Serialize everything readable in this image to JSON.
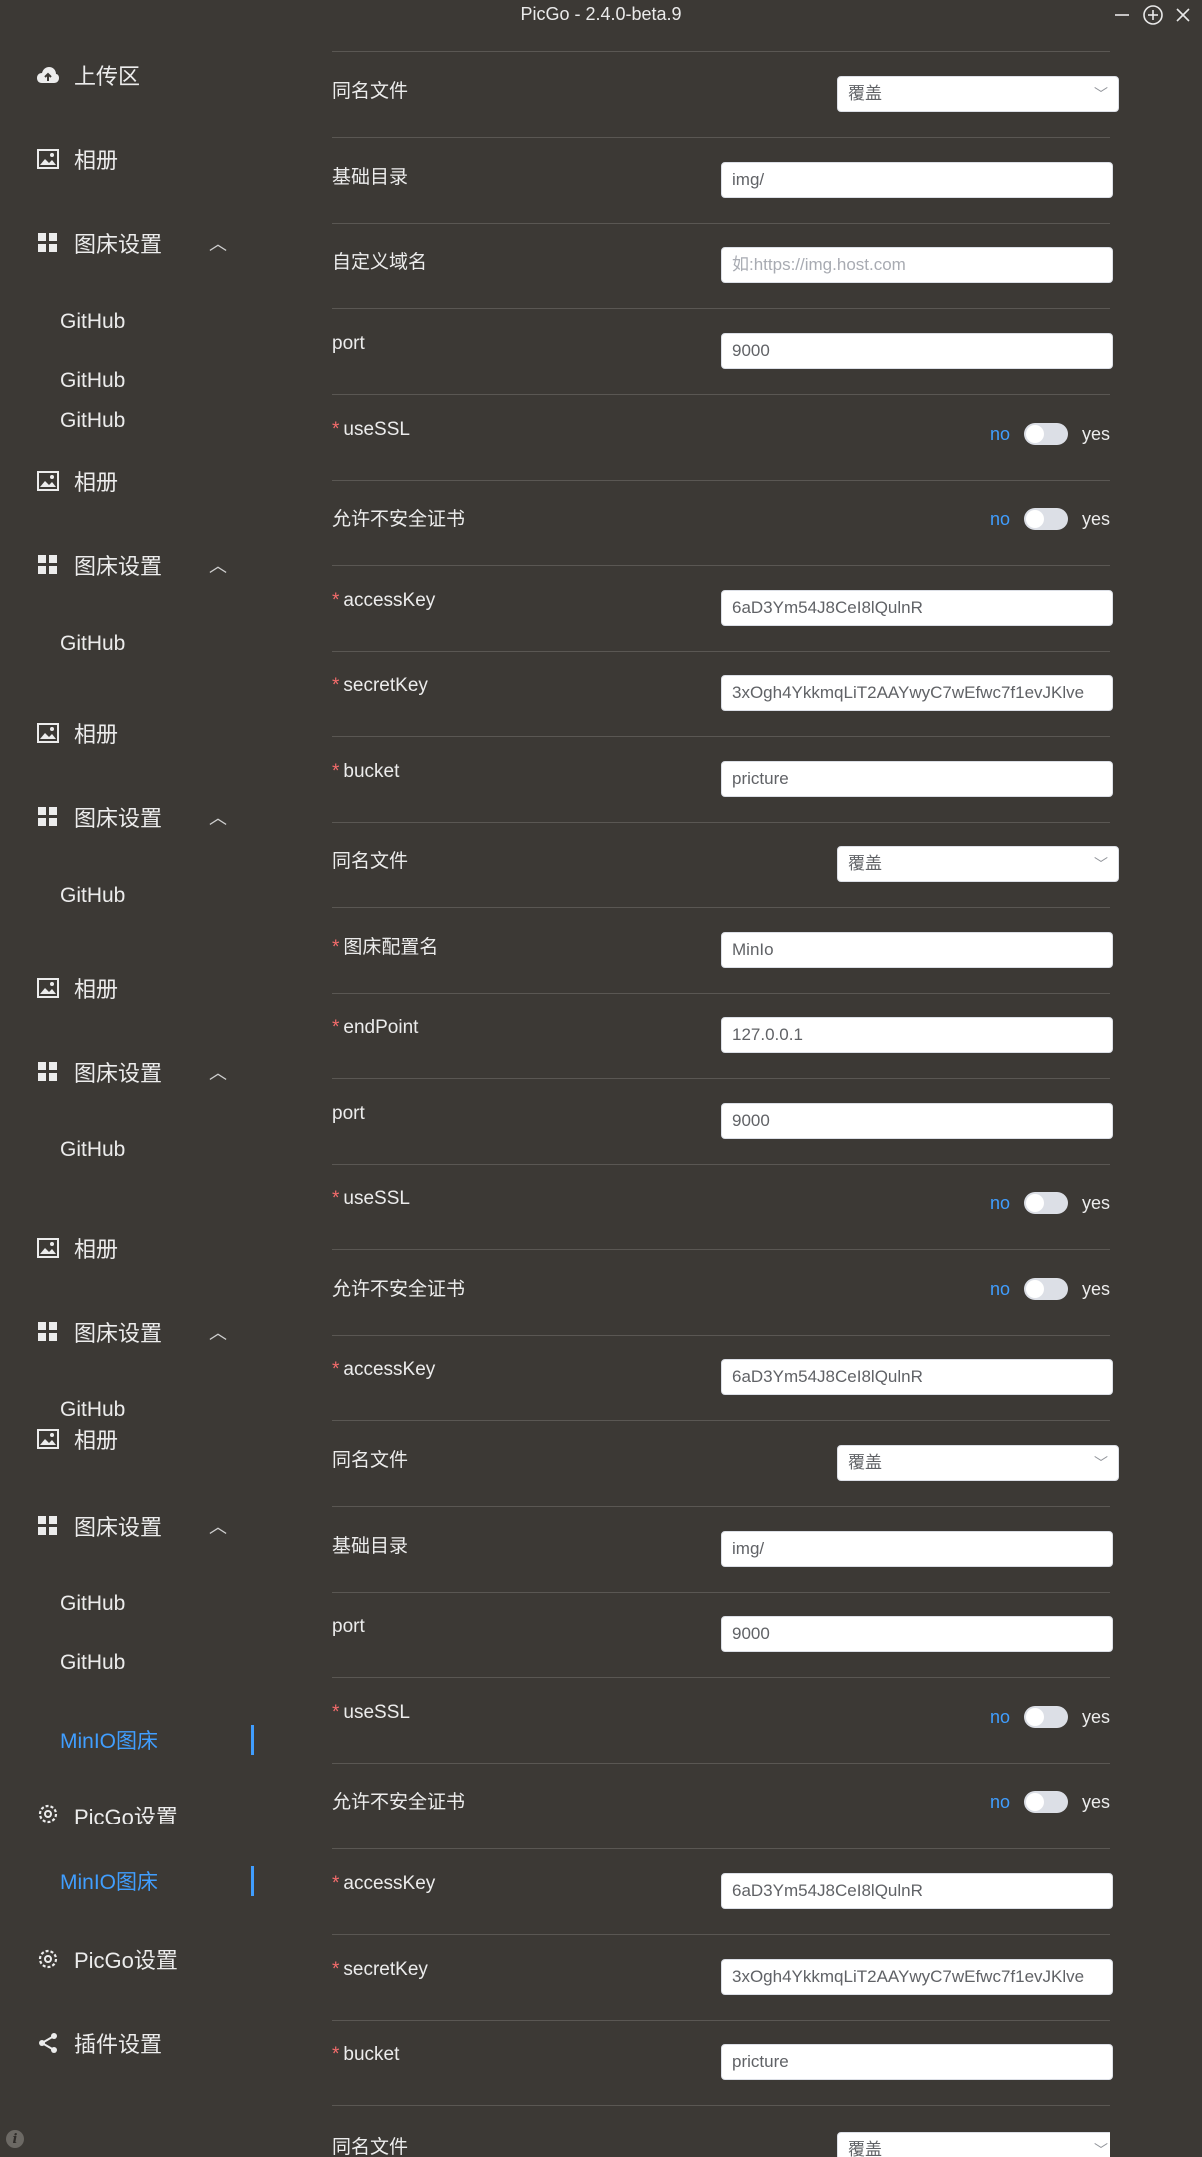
{
  "window": {
    "title": "PicGo - 2.4.0-beta.9",
    "min_icon": "minimize-icon",
    "max_icon": "maximize-icon",
    "close_icon": "close-icon"
  },
  "sidebar": {
    "upload": "上传区",
    "gallery": "相册",
    "pic_settings": "图床设置",
    "github": "GitHub",
    "minio": "MinIO图床",
    "picgo_settings": "PicGo设置",
    "plugin_settings": "插件设置"
  },
  "form": {
    "same_name_file": "同名文件",
    "overwrite": "覆盖",
    "base_dir": "基础目录",
    "base_dir_value": "img/",
    "custom_domain": "自定义域名",
    "custom_domain_placeholder": "如:https://img.host.com",
    "port": "port",
    "port_value": "9000",
    "use_ssl": "useSSL",
    "allow_insecure": "允许不安全证书",
    "no": "no",
    "yes": "yes",
    "access_key": "accessKey",
    "access_key_value": "6aD3Ym54J8CeI8lQulnR",
    "secret_key": "secretKey",
    "secret_key_value": "3xOgh4YkkmqLiT2AAYwyC7wEfwc7f1evJKlve",
    "bucket": "bucket",
    "bucket_value": "pricture",
    "config_name": "图床配置名",
    "config_name_value": "MinIo",
    "endpoint": "endPoint",
    "endpoint_value": "127.0.0.1"
  },
  "colors": {
    "background": "#3c3935",
    "accent": "#409eff",
    "required": "#f56c6c"
  }
}
